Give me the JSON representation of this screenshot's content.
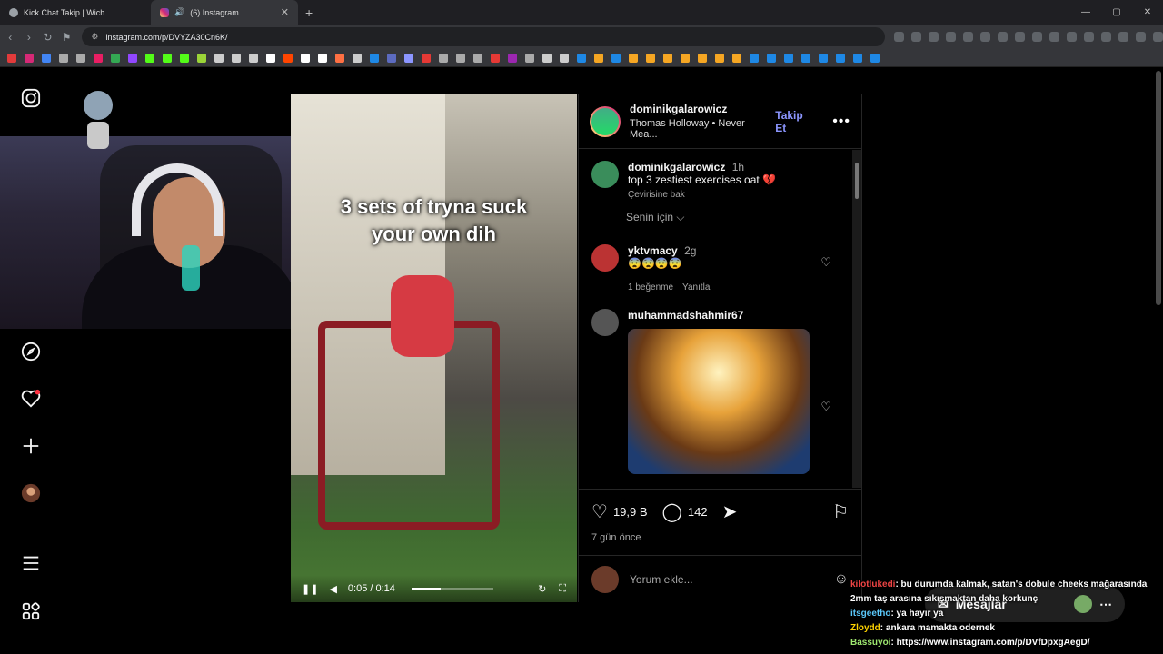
{
  "browser": {
    "tabs": [
      {
        "label": "Kick Chat Takip | Wich"
      },
      {
        "label": "(6) Instagram"
      }
    ],
    "new_tab": "+",
    "window_controls": [
      "—",
      "▢",
      "✕"
    ],
    "url": "instagram.com/p/DVYZA30Cn6K/",
    "bookmark_colors": [
      "#e23b3b",
      "#d62976",
      "#4285f4",
      "#aaa",
      "#aaa",
      "#e91e63",
      "#34a853",
      "#9147ff",
      "#53fc18",
      "#53fc18",
      "#53fc18",
      "#9bd438",
      "#ccc",
      "#ccc",
      "#ccc",
      "#fff",
      "#ff4500",
      "#fff",
      "#fff",
      "#ff7043",
      "#ccc",
      "#1e88e5",
      "#5c6bc0",
      "#8c96ff",
      "#e53935",
      "#aaa",
      "#aaa",
      "#aaa",
      "#e53935",
      "#9c27b0",
      "#aaa",
      "#ccc",
      "#ccc",
      "#1e88e5",
      "#f5a623",
      "#1e88e5",
      "#f5a623",
      "#f5a623",
      "#f5a623",
      "#f5a623",
      "#f5a623",
      "#f5a623",
      "#f5a623",
      "#1e88e5",
      "#1e88e5",
      "#1e88e5",
      "#1e88e5",
      "#1e88e5",
      "#1e88e5",
      "#1e88e5",
      "#1e88e5"
    ]
  },
  "sidebar": {
    "icons": [
      "instagram-icon",
      "explore-icon",
      "notifications-icon",
      "create-icon",
      "profile-icon",
      "more-icon",
      "threads-icon"
    ]
  },
  "post": {
    "video": {
      "caption_line1": "3 sets of tryna suck",
      "caption_line2": "your own dih",
      "time": "0:05 / 0:14",
      "progress": 0.36
    },
    "header": {
      "username": "dominikgalarowicz",
      "audio": "Thomas Holloway • Never Mea...",
      "follow": "Takip Et"
    },
    "caption": {
      "username": "dominikgalarowicz",
      "time": "1h",
      "text": "top 3 zestiest exercises oat 💔",
      "translate": "Çevirisine bak"
    },
    "sort": "Senin için ⌵",
    "comments": [
      {
        "username": "yktvmacy",
        "time": "2g",
        "text": "😨😨😨😨",
        "likes": "1 beğenme",
        "reply": "Yanıtla",
        "avatar_color": "#b33"
      },
      {
        "username": "muhammadshahmir67",
        "time": "",
        "text": "",
        "likes": "",
        "reply": "",
        "avatar_color": "#555"
      }
    ],
    "likes": "19,9 B",
    "comment_count": "142",
    "posted": "7 gün önce",
    "add_comment_placeholder": "Yorum ekle..."
  },
  "chat": [
    {
      "user": "kilotlukedi",
      "text": ": bu durumda kalmak, satan's dobule cheeks mağarasında 2mm taş arasına sıkışmaktan daha korkunç"
    },
    {
      "user": "itsgeetho",
      "text": ": ya hayır ya"
    },
    {
      "user": "Zloydd",
      "text": ": ankara mamakta odernek"
    },
    {
      "user": "Bassuyoi",
      "text": ": https://www.instagram.com/p/DVfDpxgAegD/"
    }
  ],
  "messages_pill": {
    "label": "Mesajlar"
  }
}
